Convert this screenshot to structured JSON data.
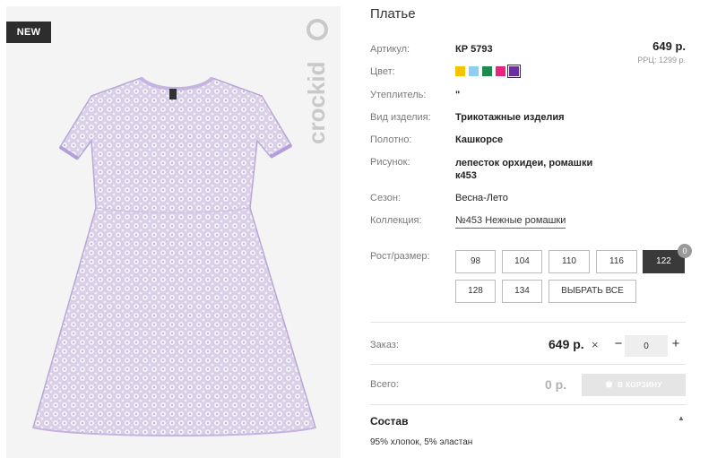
{
  "product": {
    "title": "Платье",
    "badge": "NEW",
    "brand": "crockid",
    "price": "649 р.",
    "rrc": "РРЦ: 1299 р."
  },
  "attributes": [
    {
      "label": "Артикул:",
      "value": "КР 5793"
    },
    {
      "label": "Цвет:",
      "value": ""
    },
    {
      "label": "Утеплитель:",
      "value": "\""
    },
    {
      "label": "Вид изделия:",
      "value": "Трикотажные изделия"
    },
    {
      "label": "Полотно:",
      "value": "Кашкорсе"
    },
    {
      "label": "Рисунок:",
      "value": "лепесток орхидеи, ромашки к453"
    },
    {
      "label": "Сезон:",
      "value": "Весна-Лето"
    },
    {
      "label": "Коллекция:",
      "value": "№453 Нежные ромашки"
    }
  ],
  "colors": [
    "#f5c400",
    "#8ccff2",
    "#1f8a4c",
    "#e8247f",
    "#6a2fa0"
  ],
  "selected_color_index": 4,
  "sizes": {
    "label": "Рост/размер:",
    "items": [
      "98",
      "104",
      "110",
      "116",
      "122",
      "128",
      "134"
    ],
    "selected": "122",
    "selected_count": "0",
    "select_all": "ВЫБРАТЬ ВСЕ"
  },
  "order": {
    "label": "Заказ:",
    "price": "649 р.",
    "times": "×",
    "minus": "−",
    "plus": "+",
    "qty": "0"
  },
  "total": {
    "label": "Всего:",
    "value": "0 р.",
    "cart_button": "В КОРЗИНУ"
  },
  "composition": {
    "title": "Состав",
    "text": "95% хлопок, 5% эластан"
  }
}
